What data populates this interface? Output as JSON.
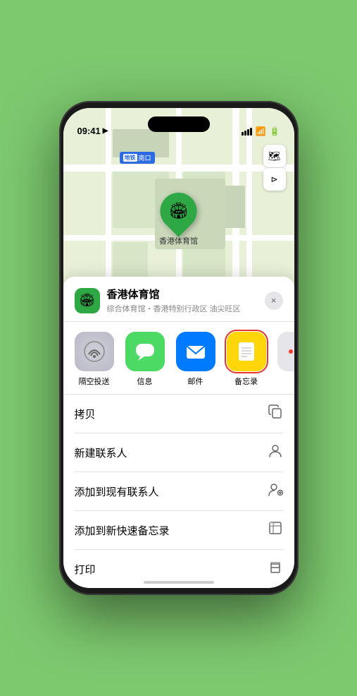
{
  "status_bar": {
    "time": "09:41",
    "location_icon": "▶"
  },
  "map": {
    "station_label": "南口",
    "pin_emoji": "🏟️",
    "place_name_on_map": "香港体育馆"
  },
  "place_card": {
    "name": "香港体育馆",
    "subtitle": "综合体育馆・香港特别行政区 油尖旺区",
    "close_label": "×"
  },
  "share_actions": [
    {
      "id": "airdrop",
      "label": "隔空投送",
      "bg": "#f0f0f0",
      "emoji": "📡",
      "bg_color": "#e8e8e8"
    },
    {
      "id": "messages",
      "label": "信息",
      "bg": "#4cd964",
      "emoji": "💬",
      "bg_color": "#4cd964"
    },
    {
      "id": "mail",
      "label": "邮件",
      "bg": "#007aff",
      "emoji": "✉️",
      "bg_color": "#007aff"
    },
    {
      "id": "notes",
      "label": "备忘录",
      "bg": "#ffcc00",
      "emoji": "📝",
      "bg_color": "#ffd60a",
      "highlighted": true
    }
  ],
  "more_dots": {
    "colors": [
      "#ff3b30",
      "#ffcc00",
      "#34c759"
    ]
  },
  "action_items": [
    {
      "label": "拷贝",
      "icon": "⎘"
    },
    {
      "label": "新建联系人",
      "icon": "👤"
    },
    {
      "label": "添加到现有联系人",
      "icon": "👥"
    },
    {
      "label": "添加到新快速备忘录",
      "icon": "⊡"
    },
    {
      "label": "打印",
      "icon": "🖨"
    }
  ]
}
